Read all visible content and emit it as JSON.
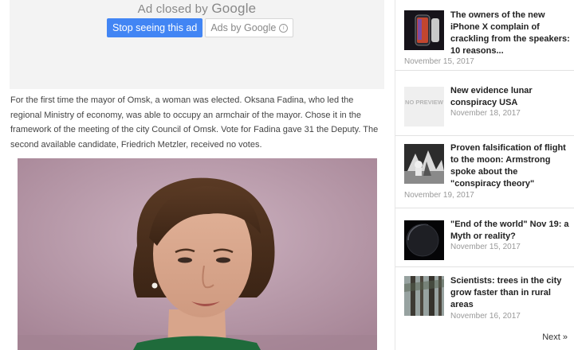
{
  "ad": {
    "closed_by": "Ad closed by",
    "google": "Google",
    "stop_seeing": "Stop seeing this ad",
    "ads_by": "Ads by Google",
    "info_symbol": "i"
  },
  "article": {
    "text": "For the first time the mayor of Omsk, a woman was elected. Oksana Fadina, who led the regional Ministry of economy, was able to occupy an armchair of the mayor. Chose it in the framework of the meeting of the city Council of Omsk. Vote for Fadina gave 31 the Deputy. The second available candidate, Friedrich Metzler, received no votes."
  },
  "sidebar": {
    "posts": [
      {
        "title": "The owners of the new iPhone X complain of crackling from the speakers: 10 reasons...",
        "date": "November 15, 2017",
        "thumb": "iphone-thumbnail"
      },
      {
        "title": "New evidence lunar conspiracy USA",
        "date": "November 18, 2017",
        "thumb": "no-preview-thumbnail",
        "no_preview_text": "NO PREVIEW"
      },
      {
        "title": "Proven falsification of flight to the moon: Armstrong spoke about the \"conspiracy theory\"",
        "date": "November 19, 2017",
        "thumb": "moon-landing-thumbnail"
      },
      {
        "title": "\"End of the world\" Nov 19: a Myth or reality?",
        "date": "November 15, 2017",
        "thumb": "dark-planet-thumbnail"
      },
      {
        "title": "Scientists: trees in the city grow faster than in rural areas",
        "date": "November 16, 2017",
        "thumb": "trees-thumbnail"
      }
    ],
    "next": "Next »"
  },
  "colors": {
    "google_blue": "#4285f4",
    "photo_background": "#b899a9"
  }
}
